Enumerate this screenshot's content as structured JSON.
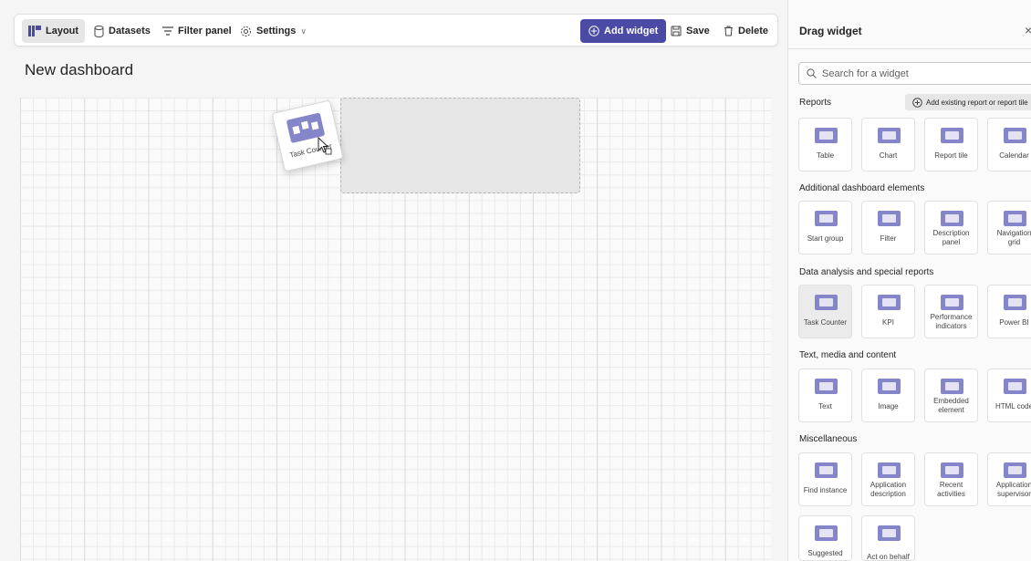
{
  "toolbar": {
    "layout": "Layout",
    "datasets": "Datasets",
    "filter_panel": "Filter panel",
    "settings": "Settings",
    "add_widget": "Add widget",
    "save": "Save",
    "delete": "Delete"
  },
  "page": {
    "title": "New dashboard"
  },
  "dragging": {
    "label": "Task Counter"
  },
  "panel": {
    "title": "Drag widget",
    "close": "×",
    "search_placeholder": "Search for a widget",
    "add_existing": "Add existing report or report tile",
    "sections": [
      {
        "title": "Reports",
        "items": [
          "Table",
          "Chart",
          "Report tile",
          "Calendar"
        ]
      },
      {
        "title": "Additional dashboard elements",
        "items": [
          "Start group",
          "Filter",
          "Description panel",
          "Navigation grid"
        ]
      },
      {
        "title": "Data analysis and special reports",
        "items": [
          "Task Counter",
          "KPI",
          "Performance indicators",
          "Power BI"
        ]
      },
      {
        "title": "Text, media and content",
        "items": [
          "Text",
          "Image",
          "Embedded element",
          "HTML code"
        ]
      },
      {
        "title": "Miscellaneous",
        "items": [
          "Find instance",
          "Application description",
          "Recent activities",
          "Application supervisor",
          "Suggested",
          "Act on behalf"
        ]
      }
    ]
  },
  "colors": {
    "accent": "#4b4ba6",
    "icon": "#8585c9"
  }
}
